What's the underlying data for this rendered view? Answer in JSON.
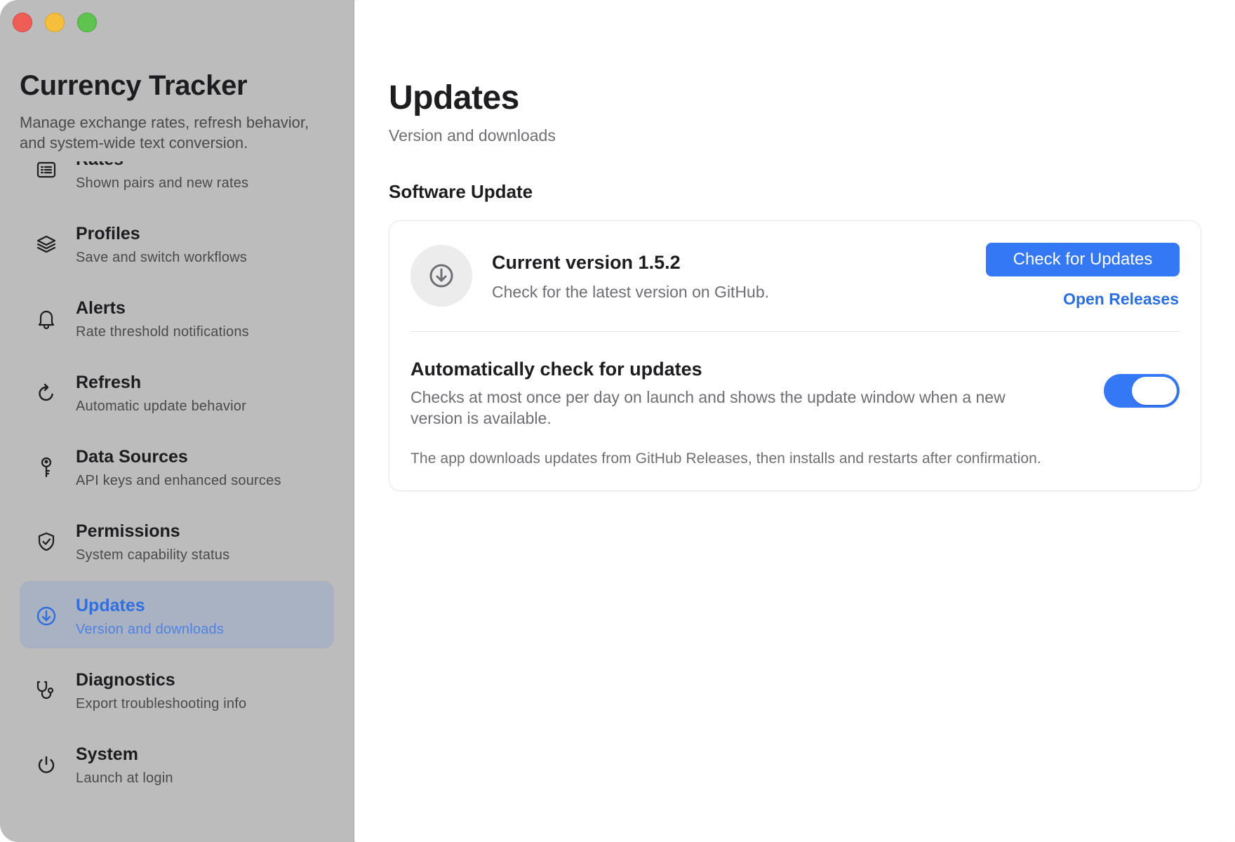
{
  "app": {
    "title": "Currency Tracker",
    "subtitle": "Manage exchange rates, refresh behavior, and system-wide text conversion."
  },
  "sidebar": {
    "items": [
      {
        "label": "Rates",
        "description": "Shown pairs and new rates",
        "icon": "list-icon"
      },
      {
        "label": "Profiles",
        "description": "Save and switch workflows",
        "icon": "layers-icon"
      },
      {
        "label": "Alerts",
        "description": "Rate threshold notifications",
        "icon": "bell-icon"
      },
      {
        "label": "Refresh",
        "description": "Automatic update behavior",
        "icon": "refresh-icon"
      },
      {
        "label": "Data Sources",
        "description": "API keys and enhanced sources",
        "icon": "key-icon"
      },
      {
        "label": "Permissions",
        "description": "System capability status",
        "icon": "shield-check-icon"
      },
      {
        "label": "Updates",
        "description": "Version and downloads",
        "icon": "download-circle-icon",
        "active": true
      },
      {
        "label": "Diagnostics",
        "description": "Export troubleshooting info",
        "icon": "stethoscope-icon"
      },
      {
        "label": "System",
        "description": "Launch at login",
        "icon": "power-icon"
      }
    ]
  },
  "main": {
    "title": "Updates",
    "subtitle": "Version and downloads",
    "section_title": "Software Update",
    "card": {
      "version_title": "Current version 1.5.2",
      "version_desc": "Check for the latest version on GitHub.",
      "check_button": "Check for Updates",
      "open_releases": "Open Releases",
      "auto_title": "Automatically check for updates",
      "auto_desc": "Checks at most once per day on launch and shows the update window when a new version is available.",
      "auto_enabled": true,
      "footnote": "The app downloads updates from GitHub Releases, then installs and restarts after confirmation."
    }
  },
  "colors": {
    "accent": "#3478f6",
    "sidebar_bg": "#bcbcbc",
    "active_item_bg": "#a9b2c3"
  }
}
